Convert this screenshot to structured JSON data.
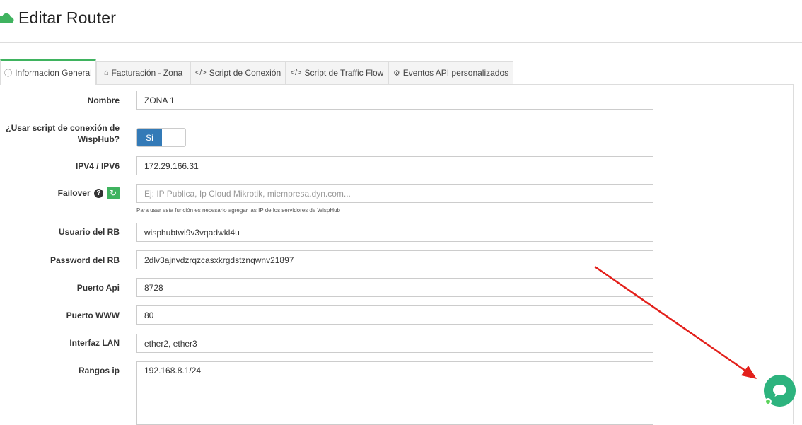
{
  "page": {
    "title": "Editar Router"
  },
  "tabs": [
    {
      "icon": "info-circle-icon",
      "label": "Informacion General",
      "active": true
    },
    {
      "icon": "home-icon",
      "label": "Facturación - Zona",
      "active": false
    },
    {
      "icon": "code-icon",
      "label": "Script de Conexión",
      "active": false
    },
    {
      "icon": "code-icon",
      "label": "Script de Traffic Flow",
      "active": false
    },
    {
      "icon": "gear-icon",
      "label": "Eventos API personalizados",
      "active": false
    }
  ],
  "form": {
    "nombre": {
      "label": "Nombre",
      "value": "ZONA 1"
    },
    "usar_script": {
      "label_line1": "¿Usar script de conexión de",
      "label_line2": "WispHub?",
      "value": "Si"
    },
    "ip": {
      "label": "IPV4 / IPV6",
      "value": "172.29.166.31"
    },
    "failover": {
      "label": "Failover",
      "value": "",
      "placeholder": "Ej: IP Publica, Ip Cloud Mikrotik, miempresa.dyn.com...",
      "help": "Para usar esta función es necesario agregar las IP de los servidores de WispHub"
    },
    "usuario": {
      "label": "Usuario del RB",
      "value": "wisphubtwi9v3vqadwkl4u"
    },
    "password": {
      "label": "Password del RB",
      "value": "2dlv3ajnvdzrqzcasxkrgdstznqwnv21897"
    },
    "puerto_api": {
      "label": "Puerto Api",
      "value": "8728"
    },
    "puerto_www": {
      "label": "Puerto WWW",
      "value": "80"
    },
    "interfaz_lan": {
      "label": "Interfaz LAN",
      "value": "ether2, ether3"
    },
    "rangos_ip": {
      "label": "Rangos ip",
      "value": "192.168.8.1/24"
    }
  },
  "colors": {
    "accent": "#3fb35f",
    "toggle": "#337ab7",
    "chat": "#2db37e",
    "arrow": "#e3201b"
  }
}
